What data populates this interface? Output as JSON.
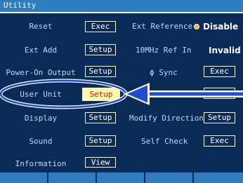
{
  "title": "Utility",
  "left_items": [
    {
      "label": "Reset",
      "button": "Exec"
    },
    {
      "label": "Ext Add",
      "button": "Setup"
    },
    {
      "label": "Power-On Output",
      "button": "Setup"
    },
    {
      "label": "User Unit",
      "button": "Setup"
    },
    {
      "label": "Display",
      "button": "Setup"
    },
    {
      "label": "Sound",
      "button": "Setup"
    },
    {
      "label": "Information",
      "button": "View"
    }
  ],
  "right_items": [
    {
      "label": "Ext Reference",
      "value": "Disable"
    },
    {
      "label": "10MHz Ref In",
      "value": "Invalid"
    },
    {
      "label": "ϕ Sync",
      "button": "Exec"
    },
    {
      "label": "Modify Direction",
      "button": "Setup"
    },
    {
      "label": "Self Check",
      "button": "Exec"
    }
  ],
  "colors": {
    "background": "#0a2a57",
    "titlebar": "#2f7cc0",
    "label": "#b8dcff",
    "highlight_fill": "#fff6a8",
    "highlight_text": "#d31a1a",
    "annotation": "#1f4fd0",
    "radio": "#f3b23a"
  },
  "annotation": {
    "highlighted_item": "User Unit",
    "icons": [
      "callout-ellipse",
      "pointer-arrow"
    ]
  }
}
